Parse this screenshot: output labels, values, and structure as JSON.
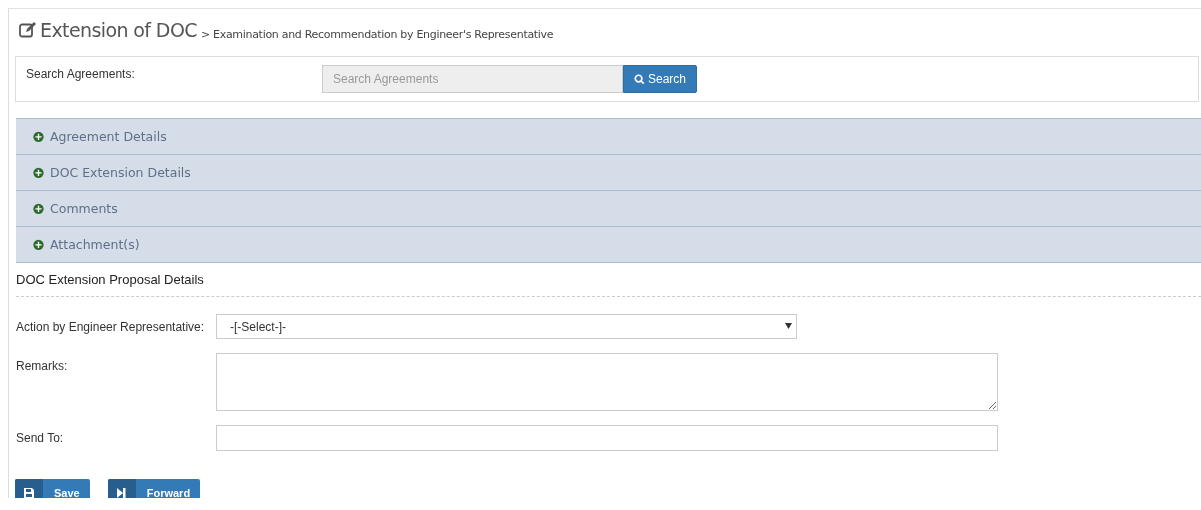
{
  "header": {
    "title": "Extension of DOC",
    "breadcrumb": "> Examination and Recommendation by Engineer's Representative"
  },
  "search": {
    "label": "Search Agreements:",
    "placeholder": "Search Agreements",
    "button": "Search"
  },
  "accordion": [
    {
      "label": "Agreement Details",
      "expanded": false
    },
    {
      "label": "DOC Extension Details",
      "expanded": false
    },
    {
      "label": "Comments",
      "expanded": false
    },
    {
      "label": "Attachment(s)",
      "expanded": false
    }
  ],
  "proposal": {
    "heading": "DOC Extension Proposal Details",
    "fields": [
      {
        "kind": "select",
        "label": "Action by Engineer Representative:",
        "value": "-[-Select-]-"
      },
      {
        "kind": "textarea",
        "label": "Remarks:"
      },
      {
        "kind": "text",
        "label": "Send To:"
      }
    ]
  },
  "buttons": [
    {
      "kind": "save",
      "label": "Save"
    },
    {
      "kind": "forward",
      "label": "Forward"
    }
  ]
}
